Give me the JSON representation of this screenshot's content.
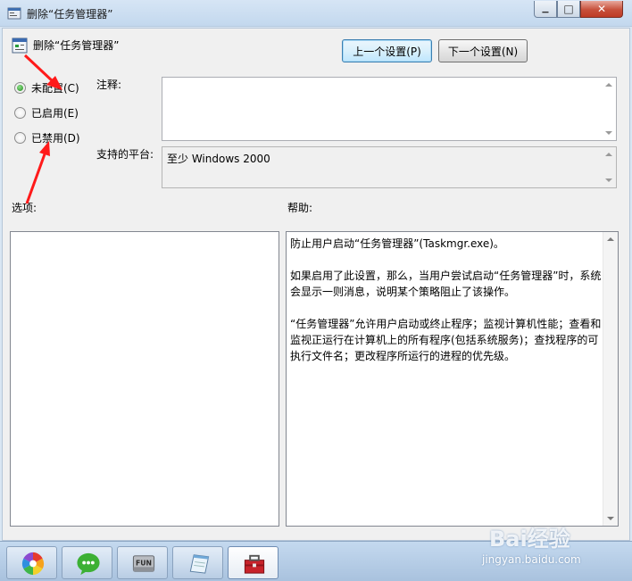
{
  "window": {
    "title": "删除“任务管理器”",
    "min_glyph": "▁",
    "max_glyph": "□",
    "close_glyph": "✕"
  },
  "header": {
    "policy_name": "删除“任务管理器”",
    "prev_button": "上一个设置(P)",
    "next_button": "下一个设置(N)"
  },
  "state": {
    "options": [
      {
        "label": "未配置(C)",
        "selected": true
      },
      {
        "label": "已启用(E)",
        "selected": false
      },
      {
        "label": "已禁用(D)",
        "selected": false
      }
    ]
  },
  "comment": {
    "label": "注释:",
    "value": ""
  },
  "platform": {
    "label": "支持的平台:",
    "value": "至少 Windows 2000"
  },
  "options_panel": {
    "label": "选项:"
  },
  "help_panel": {
    "label": "帮助:",
    "paragraphs": [
      "防止用户启动“任务管理器”(Taskmgr.exe)。",
      "如果启用了此设置，那么，当用户尝试启动“任务管理器”时，系统会显示一则消息，说明某个策略阻止了该操作。",
      "“任务管理器”允许用户启动或终止程序；监视计算机性能；查看和监视正运行在计算机上的所有程序(包括系统服务)；查找程序的可执行文件名；更改程序所运行的进程的优先级。"
    ]
  },
  "taskbar": {
    "items": [
      {
        "icon": "pinwheel-icon"
      },
      {
        "icon": "wechat-icon"
      },
      {
        "icon": "fun-drive-icon"
      },
      {
        "icon": "notepad-icon"
      },
      {
        "icon": "toolbox-icon"
      }
    ],
    "fun_text": "FUN"
  },
  "watermark": {
    "logo": "Bai经验",
    "url": "jingyan.baidu.com"
  },
  "colors": {
    "annotation_arrow": "#ff1a1a",
    "button_focus": "#3c7fb1"
  }
}
